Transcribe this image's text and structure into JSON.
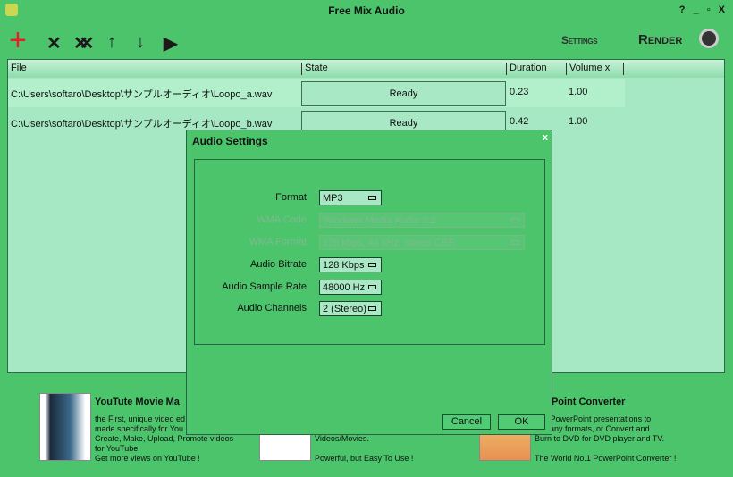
{
  "window": {
    "title": "Free Mix Audio",
    "controls": "? _ ▫ X"
  },
  "toolbar": {
    "add": "+",
    "remove": "✕",
    "remove_all": "✕✕",
    "up": "↑",
    "down": "↓",
    "play": "▶",
    "settings": "Settings",
    "render": "Render"
  },
  "table": {
    "headers": [
      "File",
      "State",
      "Duration",
      "Volume x"
    ],
    "rows": [
      {
        "file": "C:\\Users\\softaro\\Desktop\\サンプルオーディオ\\Loopo_a.wav",
        "state": "Ready",
        "duration": "0.23",
        "volume": "1.00"
      },
      {
        "file": "C:\\Users\\softaro\\Desktop\\サンプルオーディオ\\Loopo_b.wav",
        "state": "Ready",
        "duration": "0.42",
        "volume": "1.00"
      }
    ]
  },
  "dialog": {
    "title": "Audio Settings",
    "close": "x",
    "fields": [
      {
        "label": "Format",
        "value": "MP3",
        "enabled": true
      },
      {
        "label": "WMA Code",
        "value": "Windows Media Audio 9.2",
        "enabled": false
      },
      {
        "label": "WMA Format",
        "value": "128 kbps, 44 kHz, stereo CBR",
        "enabled": false
      },
      {
        "label": "Audio Bitrate",
        "value": "128 Kbps",
        "enabled": true
      },
      {
        "label": "Audio Sample Rate",
        "value": "48000 Hz",
        "enabled": true
      },
      {
        "label": "Audio Channels",
        "value": "2 (Stereo)",
        "enabled": true
      }
    ],
    "cancel": "Cancel",
    "ok": "OK"
  },
  "ads": [
    {
      "title": "YouTute Movie Ma",
      "lines": [
        "the First, unique video ed",
        "made specifically for You",
        "Create, Make, Upload, Promote videos",
        "for YouTube.",
        "Get more views on YouTube !"
      ]
    },
    {
      "title": "",
      "lines": [
        "Videos/Movies.",
        "",
        "Powerful, but Easy To Use !"
      ]
    },
    {
      "title": "werPoint Converter",
      "lines": [
        "vert PowerPoint presentations to",
        "s of any formats, or Convert and",
        "Burn to DVD for DVD player and TV.",
        "",
        "The World No.1 PowerPoint Converter !"
      ]
    }
  ]
}
